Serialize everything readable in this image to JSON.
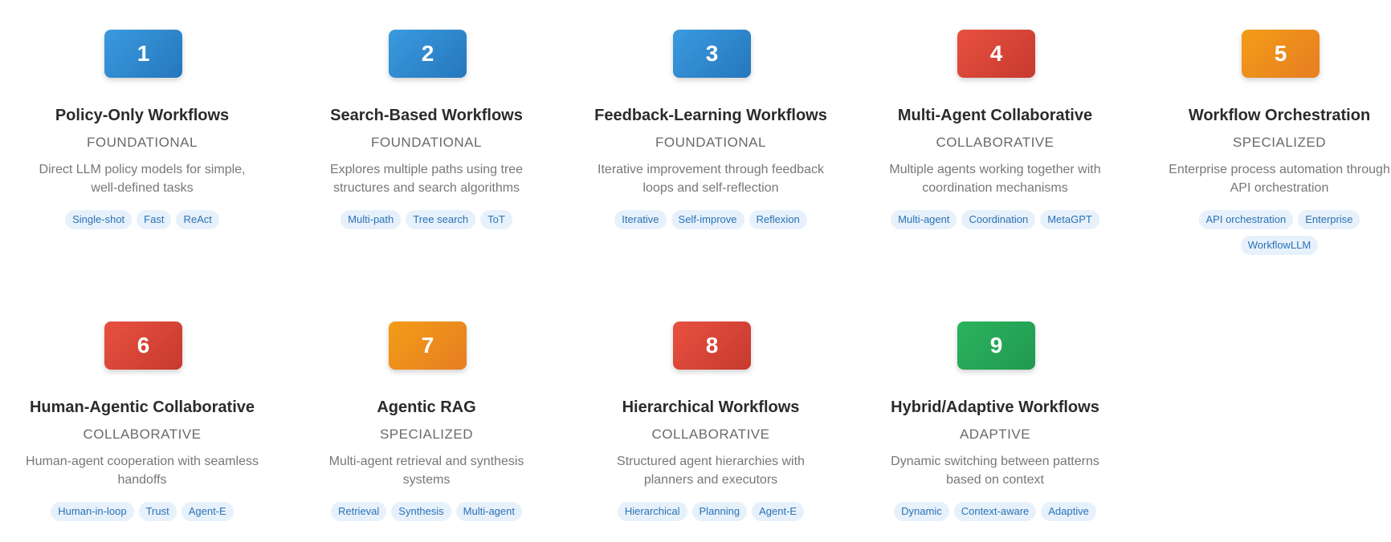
{
  "cards": [
    {
      "number": "1",
      "title": "Policy-Only Workflows",
      "category": "FOUNDATIONAL",
      "description": "Direct LLM policy models for simple, well-defined tasks",
      "tags": [
        "Single-shot",
        "Fast",
        "ReAct"
      ],
      "color": "#2f86cc"
    },
    {
      "number": "2",
      "title": "Search-Based Workflows",
      "category": "FOUNDATIONAL",
      "description": "Explores multiple paths using tree structures and search algorithms",
      "tags": [
        "Multi-path",
        "Tree search",
        "ToT"
      ],
      "color": "#2f86cc"
    },
    {
      "number": "3",
      "title": "Feedback-Learning Workflows",
      "category": "FOUNDATIONAL",
      "description": "Iterative improvement through feedback loops and self-reflection",
      "tags": [
        "Iterative",
        "Self-improve",
        "Reflexion"
      ],
      "color": "#2f86cc"
    },
    {
      "number": "4",
      "title": "Multi-Agent Collaborative",
      "category": "COLLABORATIVE",
      "description": "Multiple agents working together with coordination mechanisms",
      "tags": [
        "Multi-agent",
        "Coordination",
        "MetaGPT"
      ],
      "color": "#d94535"
    },
    {
      "number": "5",
      "title": "Workflow Orchestration",
      "category": "SPECIALIZED",
      "description": "Enterprise process automation through API orchestration",
      "tags": [
        "API orchestration",
        "Enterprise",
        "WorkflowLLM"
      ],
      "color": "#ee8e1c"
    },
    {
      "number": "6",
      "title": "Human-Agentic Collaborative",
      "category": "COLLABORATIVE",
      "description": "Human-agent cooperation with seamless handoffs",
      "tags": [
        "Human-in-loop",
        "Trust",
        "Agent-E"
      ],
      "color": "#d94535"
    },
    {
      "number": "7",
      "title": "Agentic RAG",
      "category": "SPECIALIZED",
      "description": "Multi-agent retrieval and synthesis systems",
      "tags": [
        "Retrieval",
        "Synthesis",
        "Multi-agent"
      ],
      "color": "#ee8e1c"
    },
    {
      "number": "8",
      "title": "Hierarchical Workflows",
      "category": "COLLABORATIVE",
      "description": "Structured agent hierarchies with planners and executors",
      "tags": [
        "Hierarchical",
        "Planning",
        "Agent-E"
      ],
      "color": "#d94535"
    },
    {
      "number": "9",
      "title": "Hybrid/Adaptive Workflows",
      "category": "ADAPTIVE",
      "description": "Dynamic switching between patterns based on context",
      "tags": [
        "Dynamic",
        "Context-aware",
        "Adaptive"
      ],
      "color": "#27a658"
    }
  ]
}
